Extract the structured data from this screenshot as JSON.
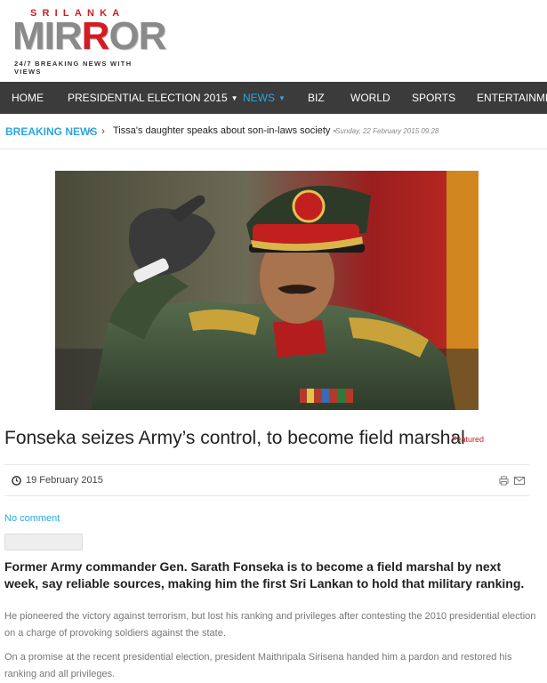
{
  "logo": {
    "top_text": "SRILANKA",
    "main_left": "MIR",
    "main_accent": "R",
    "main_right": "OR",
    "tagline": "24/7 BREAKING NEWS WITH VIEWS",
    "accent_color": "#d31c22"
  },
  "nav": {
    "items": [
      {
        "label": "HOME",
        "caret": ""
      },
      {
        "label": "PRESIDENTIAL ELECTION 2015",
        "caret": "▼"
      },
      {
        "label": "NEWS",
        "caret": "▼"
      },
      {
        "label": "BIZ",
        "caret": ""
      },
      {
        "label": "WORLD",
        "caret": ""
      },
      {
        "label": "SPORTS",
        "caret": ""
      },
      {
        "label": "ENTERTAINMENT",
        "caret": ""
      }
    ],
    "active_color": "#2aa7e0",
    "background": "#3b3b3b"
  },
  "breaking": {
    "label": "BREAKING NEWS",
    "prev_icon": "chevron-left-icon",
    "next_icon": "chevron-right-icon",
    "headline": "Tissa's daughter speaks about son-in-laws society -",
    "date": "Sunday, 22 February 2015 09:28"
  },
  "article": {
    "title": "Fonseka seizes Army’s control, to become field marshal",
    "badge": "Featured",
    "date": "19 February 2015",
    "comments_link": "No comment",
    "lead": "Former Army commander Gen. Sarath Fonseka is to become a field marshal by next week, say reliable sources, making him the first Sri Lankan to hold that military ranking.",
    "paragraphs": [
      "He pioneered the victory against terrorism, but lost his ranking and privileges after contesting the 2010 presidential election on a charge of provoking soldiers against the state.",
      "On a promise at the recent presidential election, president Maithripala Sirisena handed him a pardon and restored his ranking and all privileges."
    ]
  },
  "icons": {
    "clock": "clock-icon",
    "print": "print-icon",
    "mail": "mail-icon"
  }
}
